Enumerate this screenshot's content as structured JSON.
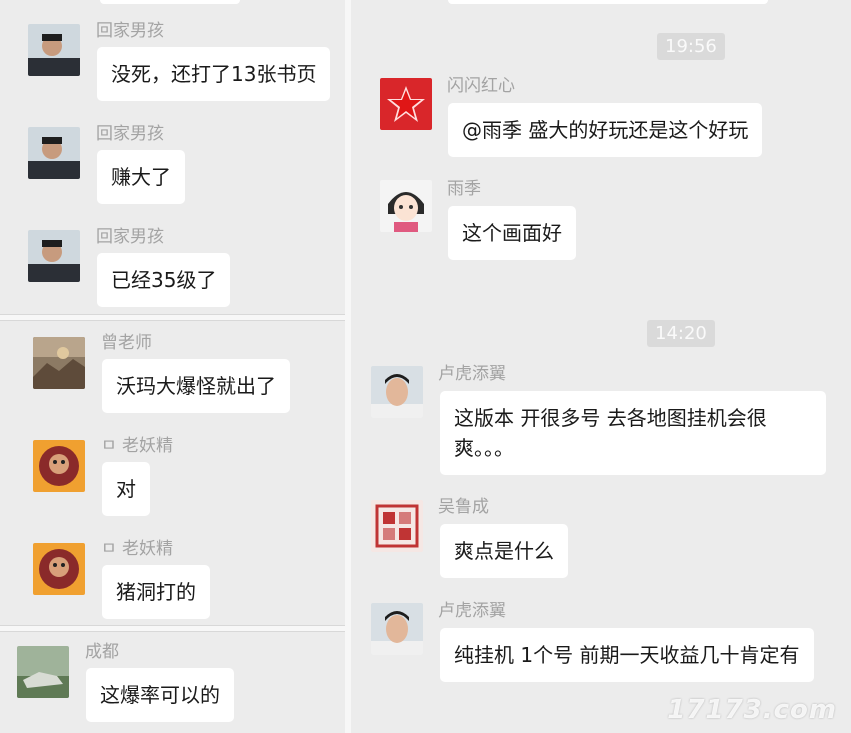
{
  "left": {
    "messages": [
      {
        "name": "回家男孩",
        "text": "没死，还打了13张书页"
      },
      {
        "name": "回家男孩",
        "text": "赚大了"
      },
      {
        "name": "回家男孩",
        "text": "已经35级了"
      },
      {
        "name": "曾老师",
        "text": "沃玛大爆怪就出了"
      },
      {
        "name": "ㅁ 老妖精",
        "text": "对"
      },
      {
        "name": "ㅁ 老妖精",
        "text": "猪洞打的"
      },
      {
        "name": "成都",
        "text": "这爆率可以的"
      }
    ]
  },
  "right": {
    "times": [
      "19:56",
      "14:20"
    ],
    "messages": [
      {
        "name": "闪闪红心",
        "text": "@雨季 盛大的好玩还是这个好玩"
      },
      {
        "name": "雨季",
        "text": "这个画面好"
      },
      {
        "name": "卢虎添翼",
        "text": "这版本  开很多号  去各地图挂机会很爽。。。"
      },
      {
        "name": "吴鲁成",
        "text": "爽点是什么"
      },
      {
        "name": "卢虎添翼",
        "text": "纯挂机  1个号  前期一天收益几十肯定有"
      }
    ]
  },
  "watermark": "17173.com",
  "colors": {
    "background": "#ececec",
    "bubble": "#ffffff",
    "name": "#a3a3a3",
    "time_badge": "#dadada"
  },
  "icons": [
    "person-avatar-icon",
    "red-star-avatar-icon",
    "cartoon-girl-avatar-icon",
    "seal-stamp-avatar-icon",
    "landscape-avatar-icon",
    "game-character-avatar-icon"
  ]
}
